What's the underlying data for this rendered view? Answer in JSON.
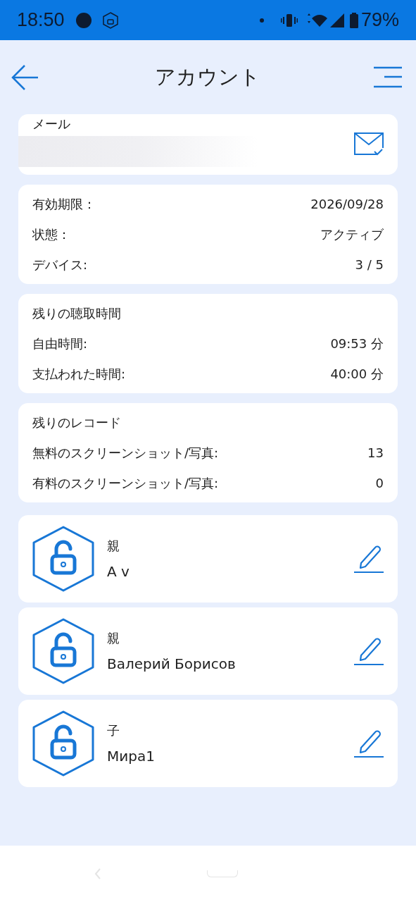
{
  "status_bar": {
    "time": "18:50",
    "battery": "79%"
  },
  "header": {
    "title": "アカウント"
  },
  "email": {
    "label": "メール"
  },
  "subscription": [
    {
      "label": "有効期限：",
      "value": "2026/09/28"
    },
    {
      "label": "状態：",
      "value": "アクティブ"
    },
    {
      "label": "デバイス:",
      "value": "3 / 5"
    }
  ],
  "listening": {
    "title": "残りの聴取時間",
    "rows": [
      {
        "label": "自由時間:",
        "value": "09:53 分"
      },
      {
        "label": "支払われた時間:",
        "value": "40:00 分"
      }
    ]
  },
  "records": {
    "title": "残りのレコード",
    "rows": [
      {
        "label": "無料のスクリーンショット/写真:",
        "value": "13"
      },
      {
        "label": "有料のスクリーンショット/写真:",
        "value": "0"
      }
    ]
  },
  "profiles": [
    {
      "role": "親",
      "name": "A v"
    },
    {
      "role": "親",
      "name": "Валерий Борисов"
    },
    {
      "role": "子",
      "name": "Мира1"
    }
  ]
}
